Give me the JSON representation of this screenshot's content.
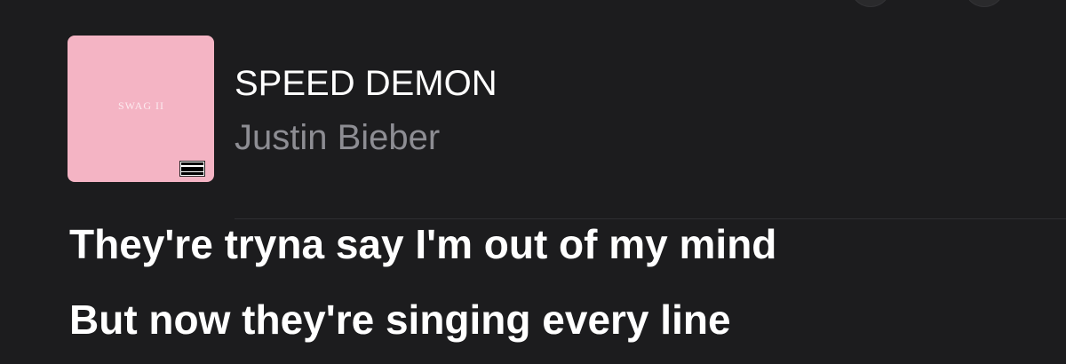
{
  "now_playing": {
    "title": "SPEED DEMON",
    "artist": "Justin Bieber",
    "artwork": {
      "text": "SWAG II",
      "background_color": "#f4b4c4",
      "badge": "parental-advisory-icon"
    }
  },
  "lyrics": [
    "They're tryna say I'm out of my mind",
    "But now they're singing every line"
  ],
  "colors": {
    "background": "#1c1c1e",
    "primary_text": "#ffffff",
    "secondary_text": "#8d8d93"
  }
}
